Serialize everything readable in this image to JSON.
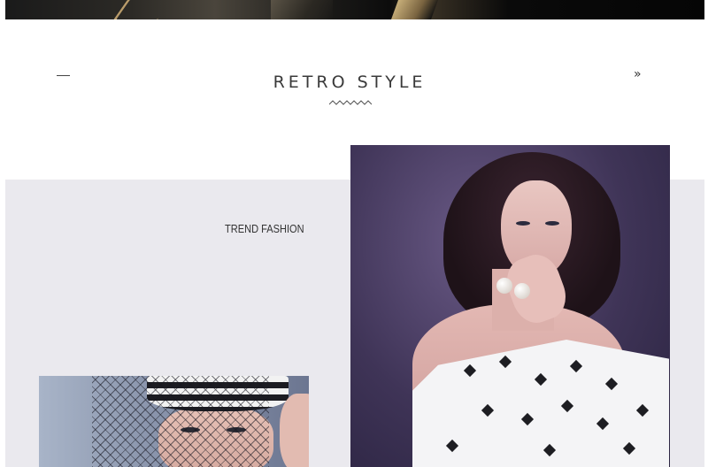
{
  "header": {
    "nav_prev_symbol": "—",
    "title": "RETRO STYLE",
    "nav_next_symbol": "»"
  },
  "panel": {
    "label": "TREND FASHION"
  },
  "images": {
    "top_banner": "jewelry-banner-photo",
    "main_photo": "model-white-dress-photo",
    "secondary_photo": "model-veil-hat-photo"
  },
  "colors": {
    "panel_background": "#eae9ee",
    "title_text": "#3a3a3a",
    "main_photo_backdrop": "#3f3457"
  }
}
